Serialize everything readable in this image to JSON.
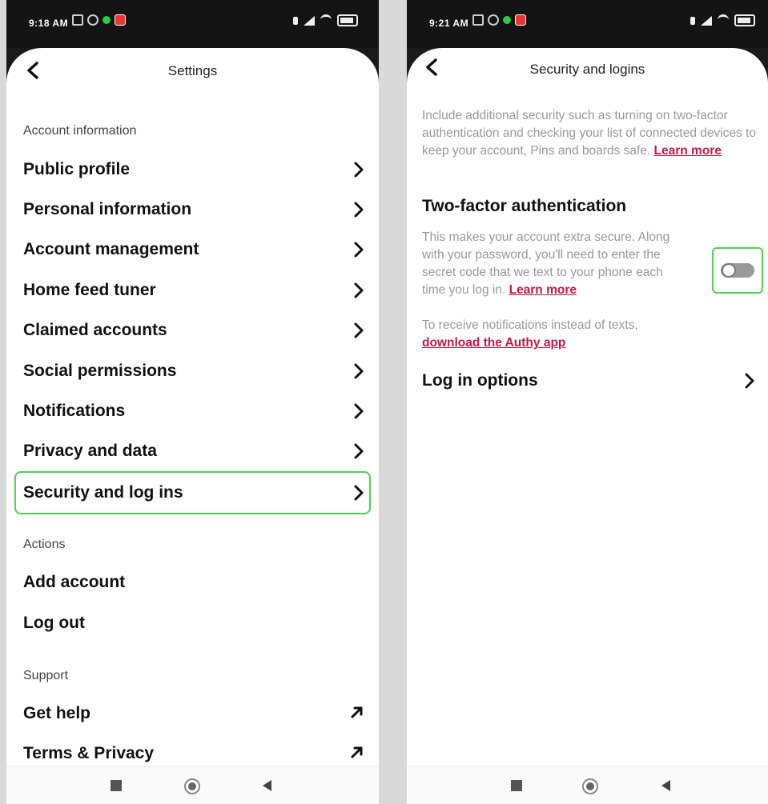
{
  "left": {
    "status": {
      "time": "9:18 AM"
    },
    "header": {
      "title": "Settings"
    },
    "sections": {
      "account_information": "Account information",
      "actions": "Actions",
      "support": "Support"
    },
    "items": [
      {
        "label": "Public profile"
      },
      {
        "label": "Personal information"
      },
      {
        "label": "Account management"
      },
      {
        "label": "Home feed tuner"
      },
      {
        "label": "Claimed accounts"
      },
      {
        "label": "Social permissions"
      },
      {
        "label": "Notifications"
      },
      {
        "label": "Privacy and data"
      },
      {
        "label": "Security and log ins"
      }
    ],
    "actions": [
      {
        "label": "Add account"
      },
      {
        "label": "Log out"
      }
    ],
    "support": [
      {
        "label": "Get help"
      },
      {
        "label": "Terms & Privacy"
      }
    ]
  },
  "right": {
    "status": {
      "time": "9:21 AM"
    },
    "header": {
      "title": "Security and logins"
    },
    "intro": {
      "text": "Include additional security such as turning on two-factor authentication and checking your list of connected devices to keep your account, Pins and boards safe.",
      "link": "Learn more"
    },
    "two_factor": {
      "heading": "Two-factor authentication",
      "text": "This makes your account extra secure. Along with your password, you'll need to enter the secret code that we text to your phone each time you log in.",
      "link": "Learn more",
      "toggle_on": false
    },
    "authy": {
      "text": "To receive notifications instead of texts,",
      "link": "download the Authy app"
    },
    "login_options": {
      "label": "Log in options"
    }
  },
  "colors": {
    "highlight": "#4fd34f",
    "link": "#c8164a"
  }
}
